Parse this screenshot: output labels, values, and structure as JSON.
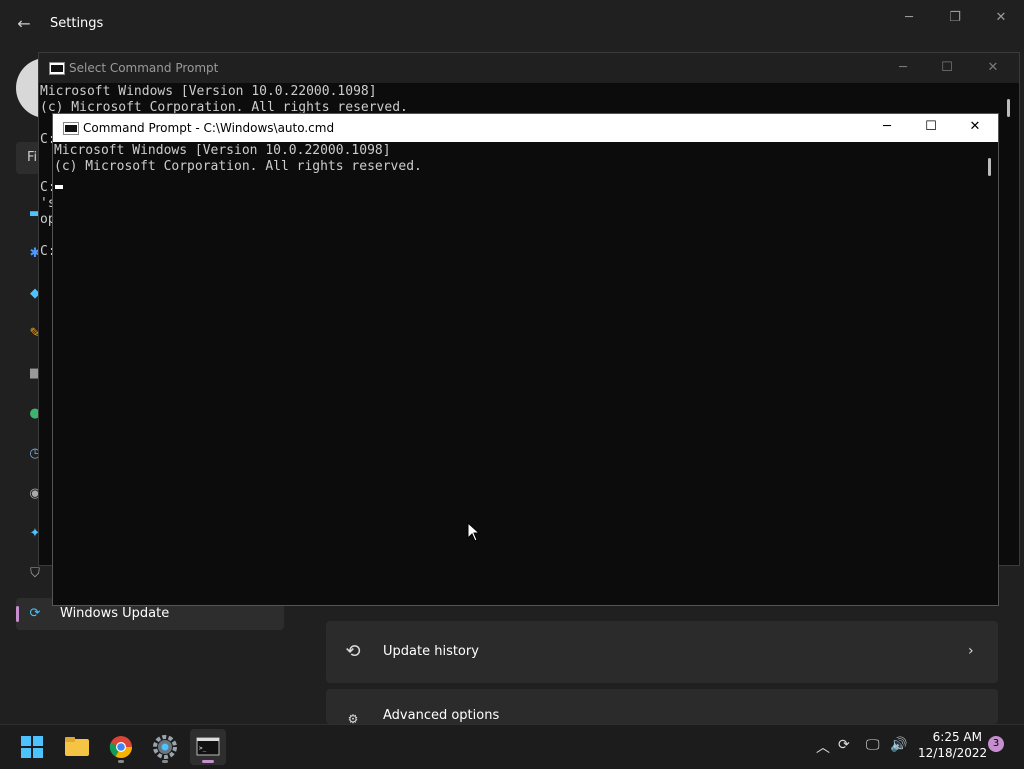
{
  "settings": {
    "title": "Settings",
    "find_placeholder": "Fi",
    "nav_selected": "Windows Update",
    "cards": [
      {
        "label": "Update history"
      },
      {
        "label": "Advanced options"
      }
    ]
  },
  "cmd_back": {
    "title": "Select Command Prompt",
    "lines": [
      "Microsoft Windows [Version 10.0.22000.1098]",
      "(c) Microsoft Corporation. All rights reserved.",
      "C:",
      "C:",
      "'s",
      "op",
      "C:"
    ]
  },
  "cmd_front": {
    "title": "Command Prompt - C:\\Windows\\auto.cmd",
    "lines": [
      "Microsoft Windows [Version 10.0.22000.1098]",
      "(c) Microsoft Corporation. All rights reserved."
    ]
  },
  "taskbar": {
    "apps": [
      "start-icon",
      "file-explorer-icon",
      "chrome-icon",
      "settings-icon",
      "terminal-icon"
    ],
    "time": "6:25 AM",
    "date": "12/18/2022",
    "notification_count": "3"
  },
  "colors": {
    "accent": "#c58ecf",
    "terminal_bg": "#0c0c0c",
    "terminal_text": "#cccccc",
    "settings_bg": "#202020"
  }
}
